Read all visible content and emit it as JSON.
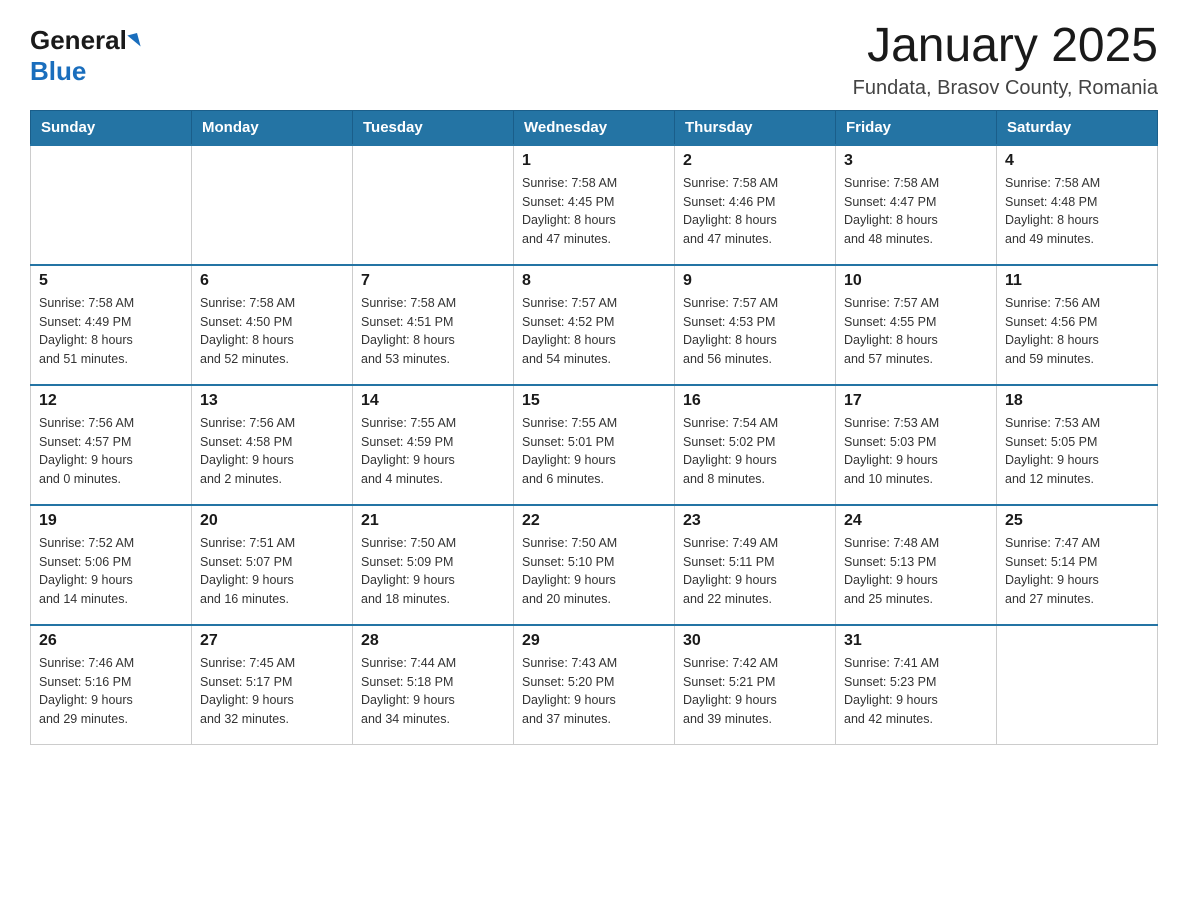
{
  "header": {
    "logo_general": "General",
    "logo_blue": "Blue",
    "month_title": "January 2025",
    "subtitle": "Fundata, Brasov County, Romania"
  },
  "days_of_week": [
    "Sunday",
    "Monday",
    "Tuesday",
    "Wednesday",
    "Thursday",
    "Friday",
    "Saturday"
  ],
  "weeks": [
    {
      "days": [
        {
          "number": "",
          "info": ""
        },
        {
          "number": "",
          "info": ""
        },
        {
          "number": "",
          "info": ""
        },
        {
          "number": "1",
          "info": "Sunrise: 7:58 AM\nSunset: 4:45 PM\nDaylight: 8 hours\nand 47 minutes."
        },
        {
          "number": "2",
          "info": "Sunrise: 7:58 AM\nSunset: 4:46 PM\nDaylight: 8 hours\nand 47 minutes."
        },
        {
          "number": "3",
          "info": "Sunrise: 7:58 AM\nSunset: 4:47 PM\nDaylight: 8 hours\nand 48 minutes."
        },
        {
          "number": "4",
          "info": "Sunrise: 7:58 AM\nSunset: 4:48 PM\nDaylight: 8 hours\nand 49 minutes."
        }
      ]
    },
    {
      "days": [
        {
          "number": "5",
          "info": "Sunrise: 7:58 AM\nSunset: 4:49 PM\nDaylight: 8 hours\nand 51 minutes."
        },
        {
          "number": "6",
          "info": "Sunrise: 7:58 AM\nSunset: 4:50 PM\nDaylight: 8 hours\nand 52 minutes."
        },
        {
          "number": "7",
          "info": "Sunrise: 7:58 AM\nSunset: 4:51 PM\nDaylight: 8 hours\nand 53 minutes."
        },
        {
          "number": "8",
          "info": "Sunrise: 7:57 AM\nSunset: 4:52 PM\nDaylight: 8 hours\nand 54 minutes."
        },
        {
          "number": "9",
          "info": "Sunrise: 7:57 AM\nSunset: 4:53 PM\nDaylight: 8 hours\nand 56 minutes."
        },
        {
          "number": "10",
          "info": "Sunrise: 7:57 AM\nSunset: 4:55 PM\nDaylight: 8 hours\nand 57 minutes."
        },
        {
          "number": "11",
          "info": "Sunrise: 7:56 AM\nSunset: 4:56 PM\nDaylight: 8 hours\nand 59 minutes."
        }
      ]
    },
    {
      "days": [
        {
          "number": "12",
          "info": "Sunrise: 7:56 AM\nSunset: 4:57 PM\nDaylight: 9 hours\nand 0 minutes."
        },
        {
          "number": "13",
          "info": "Sunrise: 7:56 AM\nSunset: 4:58 PM\nDaylight: 9 hours\nand 2 minutes."
        },
        {
          "number": "14",
          "info": "Sunrise: 7:55 AM\nSunset: 4:59 PM\nDaylight: 9 hours\nand 4 minutes."
        },
        {
          "number": "15",
          "info": "Sunrise: 7:55 AM\nSunset: 5:01 PM\nDaylight: 9 hours\nand 6 minutes."
        },
        {
          "number": "16",
          "info": "Sunrise: 7:54 AM\nSunset: 5:02 PM\nDaylight: 9 hours\nand 8 minutes."
        },
        {
          "number": "17",
          "info": "Sunrise: 7:53 AM\nSunset: 5:03 PM\nDaylight: 9 hours\nand 10 minutes."
        },
        {
          "number": "18",
          "info": "Sunrise: 7:53 AM\nSunset: 5:05 PM\nDaylight: 9 hours\nand 12 minutes."
        }
      ]
    },
    {
      "days": [
        {
          "number": "19",
          "info": "Sunrise: 7:52 AM\nSunset: 5:06 PM\nDaylight: 9 hours\nand 14 minutes."
        },
        {
          "number": "20",
          "info": "Sunrise: 7:51 AM\nSunset: 5:07 PM\nDaylight: 9 hours\nand 16 minutes."
        },
        {
          "number": "21",
          "info": "Sunrise: 7:50 AM\nSunset: 5:09 PM\nDaylight: 9 hours\nand 18 minutes."
        },
        {
          "number": "22",
          "info": "Sunrise: 7:50 AM\nSunset: 5:10 PM\nDaylight: 9 hours\nand 20 minutes."
        },
        {
          "number": "23",
          "info": "Sunrise: 7:49 AM\nSunset: 5:11 PM\nDaylight: 9 hours\nand 22 minutes."
        },
        {
          "number": "24",
          "info": "Sunrise: 7:48 AM\nSunset: 5:13 PM\nDaylight: 9 hours\nand 25 minutes."
        },
        {
          "number": "25",
          "info": "Sunrise: 7:47 AM\nSunset: 5:14 PM\nDaylight: 9 hours\nand 27 minutes."
        }
      ]
    },
    {
      "days": [
        {
          "number": "26",
          "info": "Sunrise: 7:46 AM\nSunset: 5:16 PM\nDaylight: 9 hours\nand 29 minutes."
        },
        {
          "number": "27",
          "info": "Sunrise: 7:45 AM\nSunset: 5:17 PM\nDaylight: 9 hours\nand 32 minutes."
        },
        {
          "number": "28",
          "info": "Sunrise: 7:44 AM\nSunset: 5:18 PM\nDaylight: 9 hours\nand 34 minutes."
        },
        {
          "number": "29",
          "info": "Sunrise: 7:43 AM\nSunset: 5:20 PM\nDaylight: 9 hours\nand 37 minutes."
        },
        {
          "number": "30",
          "info": "Sunrise: 7:42 AM\nSunset: 5:21 PM\nDaylight: 9 hours\nand 39 minutes."
        },
        {
          "number": "31",
          "info": "Sunrise: 7:41 AM\nSunset: 5:23 PM\nDaylight: 9 hours\nand 42 minutes."
        },
        {
          "number": "",
          "info": ""
        }
      ]
    }
  ]
}
